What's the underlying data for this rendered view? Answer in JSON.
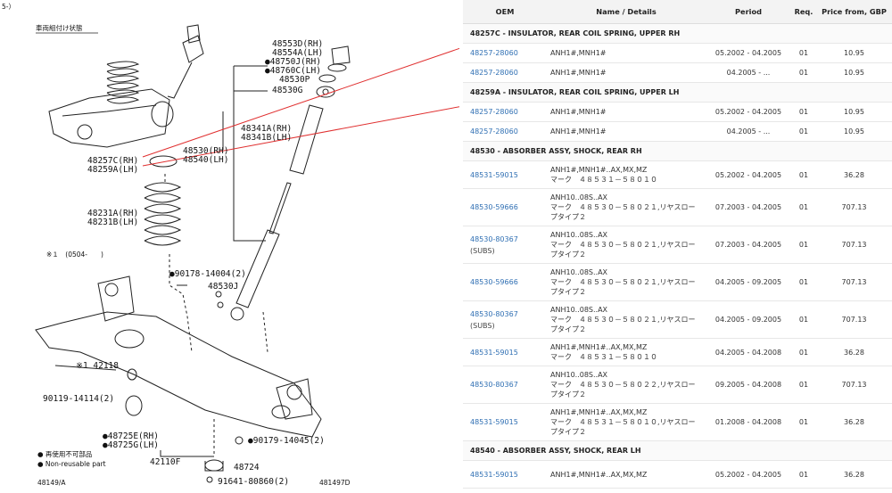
{
  "diagram": {
    "corner_label": "5-）",
    "heading": "車両組付け状態",
    "note_one": "※１　(0504-　　)",
    "legend_jp": "● 再使用不可部品",
    "legend_en": "● Non-reusable part",
    "footer_left": "48149/A",
    "footer_right": "481497D",
    "labels": {
      "l1": "48553D(RH)",
      "l2": "48554A(LH)",
      "l3": "●48750J(RH)",
      "l4": "●48760C(LH)",
      "l5": "48530P",
      "l6": "48530G",
      "l7": "48341A(RH)",
      "l8": "48341B(LH)",
      "l9": "48530(RH)",
      "l10": "48540(LH)",
      "l11": "48257C(RH)",
      "l12": "48259A(LH)",
      "l13": "48231A(RH)",
      "l14": "48231B(LH)",
      "l15": "●90178-14004(2)",
      "l16": "48530J",
      "l17": "※1 42118",
      "l18": "90119-14114(2)",
      "l19": "●48725E(RH)",
      "l20": "●48725G(LH)",
      "l21": "●90179-14045(2)",
      "l22": "42110F",
      "l23": "48724",
      "l24": "91641-80860(2)"
    }
  },
  "table": {
    "headers": [
      "OEM",
      "Name / Details",
      "Period",
      "Req.",
      "Price from, GBP"
    ],
    "rows": [
      {
        "group": "48257C - INSULATOR, REAR COIL SPRING, UPPER RH"
      },
      {
        "oem": "48257-28060",
        "details": [
          "ANH1#,MNH1#"
        ],
        "period": "05.2002 - 04.2005",
        "req": "01",
        "price": "10.95",
        "h": "r1"
      },
      {
        "oem": "48257-28060",
        "details": [
          "ANH1#,MNH1#"
        ],
        "period": "04.2005 - ...",
        "req": "01",
        "price": "10.95",
        "h": "r1"
      },
      {
        "group": "48259A - INSULATOR, REAR COIL SPRING, UPPER LH"
      },
      {
        "oem": "48257-28060",
        "details": [
          "ANH1#,MNH1#"
        ],
        "period": "05.2002 - 04.2005",
        "req": "01",
        "price": "10.95",
        "h": "r1"
      },
      {
        "oem": "48257-28060",
        "details": [
          "ANH1#,MNH1#"
        ],
        "period": "04.2005 - ...",
        "req": "01",
        "price": "10.95",
        "h": "r1"
      },
      {
        "group": "48530 - ABSORBER ASSY, SHOCK, REAR RH"
      },
      {
        "oem": "48531-59015",
        "details": [
          "ANH1#,MNH1#..AX,MX,MZ",
          "マーク　４８５３１－５８０１０"
        ],
        "period": "05.2002 - 04.2005",
        "req": "01",
        "price": "36.28",
        "h": "r2"
      },
      {
        "oem": "48530-59666",
        "details": [
          "ANH10..08S..AX",
          "マーク　４８５３０－５８０２１,リヤスロー",
          "プタイプ２"
        ],
        "period": "07.2003 - 04.2005",
        "req": "01",
        "price": "707.13",
        "h": "r3"
      },
      {
        "oem": "48530-80367",
        "subs": "(SUBS)",
        "details": [
          "ANH10..08S..AX",
          "マーク　４８５３０－５８０２１,リヤスロー",
          "プタイプ２"
        ],
        "period": "07.2003 - 04.2005",
        "req": "01",
        "price": "707.13",
        "h": "r3"
      },
      {
        "oem": "48530-59666",
        "details": [
          "ANH10..08S..AX",
          "マーク　４８５３０－５８０２１,リヤスロー",
          "プタイプ２"
        ],
        "period": "04.2005 - 09.2005",
        "req": "01",
        "price": "707.13",
        "h": "r3"
      },
      {
        "oem": "48530-80367",
        "subs": "(SUBS)",
        "details": [
          "ANH10..08S..AX",
          "マーク　４８５３０－５８０２１,リヤスロー",
          "プタイプ２"
        ],
        "period": "04.2005 - 09.2005",
        "req": "01",
        "price": "707.13",
        "h": "r3"
      },
      {
        "oem": "48531-59015",
        "details": [
          "ANH1#,MNH1#..AX,MX,MZ",
          "マーク　４８５３１－５８０１０"
        ],
        "period": "04.2005 - 04.2008",
        "req": "01",
        "price": "36.28",
        "h": "r2"
      },
      {
        "oem": "48530-80367",
        "details": [
          "ANH10..08S..AX",
          "マーク　４８５３０－５８０２２,リヤスロー",
          "プタイプ２"
        ],
        "period": "09.2005 - 04.2008",
        "req": "01",
        "price": "707.13",
        "h": "r3"
      },
      {
        "oem": "48531-59015",
        "details": [
          "ANH1#,MNH1#..AX,MX,MZ",
          "マーク　４８５３１－５８０１０,リヤスロー",
          "プタイプ２"
        ],
        "period": "01.2008 - 04.2008",
        "req": "01",
        "price": "36.28",
        "h": "r3"
      },
      {
        "group": "48540 - ABSORBER ASSY, SHOCK, REAR LH"
      },
      {
        "oem": "48531-59015",
        "details": [
          "ANH1#,MNH1#..AX,MX,MZ"
        ],
        "period": "05.2002 - 04.2005",
        "req": "01",
        "price": "36.28",
        "h": "r2"
      }
    ]
  },
  "colors": {
    "link": "#2f6fb3",
    "callout": "#e03030"
  }
}
